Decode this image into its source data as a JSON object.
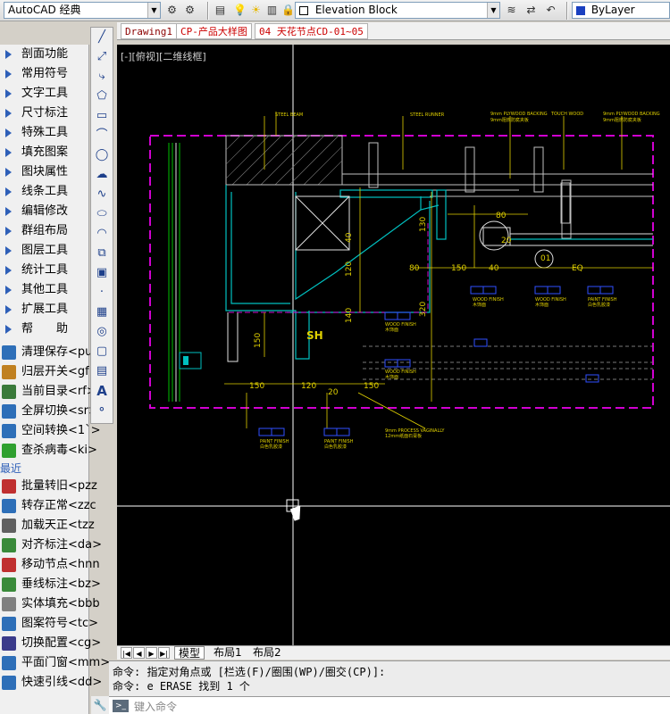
{
  "toolbar": {
    "workspace": "AutoCAD 经典",
    "layer": "Elevation Block",
    "color": "ByLayer"
  },
  "tabs": [
    {
      "label": "Drawing1",
      "color": "#8b0000"
    },
    {
      "label": "CP-产品大样图",
      "color": "#cc0000"
    },
    {
      "label": "04 天花节点CD-01~05",
      "color": "#cc0000"
    }
  ],
  "view_label": "[-][俯视][二维线框]",
  "menu": {
    "groups": [
      "剖面功能",
      "常用符号",
      "文字工具",
      "尺寸标注",
      "特殊工具",
      "填充图案",
      "图块属性",
      "线条工具",
      "编辑修改",
      "群组布局",
      "图层工具",
      "统计工具",
      "其他工具",
      "扩展工具",
      "帮　　助"
    ],
    "commands1": [
      "清理保存<pu>",
      "归层开关<gf>",
      "当前目录<rf>",
      "全屏切换<sr>",
      "空间转换<1`>",
      "查杀病毒<ki>"
    ],
    "recent_label": "最近",
    "commands2": [
      "批量转旧<pzz",
      "转存正常<zzc",
      "加载天正<tzz",
      "对齐标注<da>",
      "移动节点<hnn",
      "垂线标注<bz>",
      "实体填充<bbb",
      "图案符号<tc>",
      "切换配置<cg>",
      "平面门窗<mm>",
      "快速引线<dd>"
    ]
  },
  "drawing": {
    "dims": [
      "40",
      "120",
      "140",
      "130",
      "320",
      "150",
      "80",
      "150",
      "40",
      "EQ",
      "80",
      "20",
      "150",
      "120",
      "150",
      "20",
      "01"
    ],
    "labels": [
      "SH",
      "WOOD FINISH",
      "木饰面",
      "PAINT FINISH",
      "白色乳胶漆",
      "9mm PLYWOOD BACKING",
      "9mm阻燃防腐夹板",
      "9mm PROCESS VAGINALLY",
      "12mm纸面石膏板"
    ]
  },
  "layout_tabs": [
    "模型",
    "布局1",
    "布局2"
  ],
  "command": {
    "line1": "命令: 指定对角点或 [栏选(F)/圈围(WP)/圈交(CP)]:",
    "line2": "命令: e ERASE 找到 1 个",
    "placeholder": "键入命令"
  }
}
